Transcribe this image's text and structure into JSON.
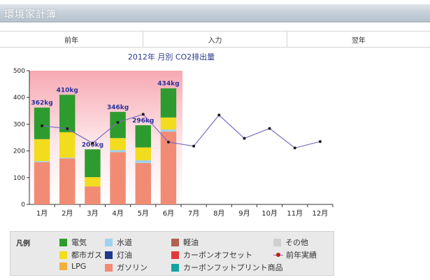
{
  "window": {
    "title": "環境家計簿"
  },
  "nav": {
    "prev": "前年",
    "input": "入力",
    "next": "翌年"
  },
  "colors": {
    "electricity": "#2e9b2e",
    "city_gas": "#f2dc1e",
    "lpg": "#f0b040",
    "water": "#9fd2f0",
    "kerosene": "#1f3a8c",
    "gasoline": "#f28b73",
    "light_oil": "#b06050",
    "carbon_offset": "#e03a3a",
    "carbon_footprint": "#13a3a3",
    "other": "#cfcfcf",
    "prev_year_line": "#7b6bc2",
    "prev_year_marker": "#1a1a1a"
  },
  "chart_data": {
    "type": "bar",
    "title": "2012年 月別 CO2排出量",
    "categories": [
      "1月",
      "2月",
      "3月",
      "4月",
      "5月",
      "6月",
      "7月",
      "8月",
      "9月",
      "10月",
      "11月",
      "12月"
    ],
    "ylim": [
      0,
      500
    ],
    "yticks": [
      0,
      100,
      200,
      300,
      400,
      500
    ],
    "stacked": true,
    "series": [
      {
        "name": "ガソリン",
        "color_key": "gasoline",
        "values": [
          158,
          172,
          67,
          195,
          155,
          272,
          null,
          null,
          null,
          null,
          null,
          null
        ]
      },
      {
        "name": "水道",
        "color_key": "water",
        "values": [
          4,
          3,
          0,
          8,
          10,
          8,
          null,
          null,
          null,
          null,
          null,
          null
        ]
      },
      {
        "name": "都市ガス",
        "color_key": "city_gas",
        "values": [
          82,
          95,
          35,
          45,
          48,
          45,
          null,
          null,
          null,
          null,
          null,
          null
        ]
      },
      {
        "name": "電気",
        "color_key": "electricity",
        "values": [
          118,
          140,
          104,
          98,
          83,
          109,
          null,
          null,
          null,
          null,
          null,
          null
        ]
      }
    ],
    "totals_labels": [
      "362kg",
      "410kg",
      "206kg",
      "346kg",
      "296kg",
      "434kg",
      "",
      "",
      "",
      "",
      "",
      ""
    ],
    "prev_year": {
      "name": "前年実績",
      "values": [
        294,
        283,
        229,
        307,
        337,
        233,
        218,
        334,
        247,
        284,
        211,
        235
      ]
    },
    "legend": {
      "title": "凡例",
      "items": [
        {
          "label": "電気",
          "color_key": "electricity"
        },
        {
          "label": "水道",
          "color_key": "water"
        },
        {
          "label": "軽油",
          "color_key": "light_oil"
        },
        {
          "label": "その他",
          "color_key": "other"
        },
        {
          "label": "都市ガス",
          "color_key": "city_gas"
        },
        {
          "label": "灯油",
          "color_key": "kerosene"
        },
        {
          "label": "カーボンオフセット",
          "color_key": "carbon_offset"
        },
        {
          "label": "前年実績",
          "color_key": "prev_year_marker",
          "line": true
        },
        {
          "label": "LPG",
          "color_key": "lpg"
        },
        {
          "label": "ガソリン",
          "color_key": "gasoline"
        },
        {
          "label": "カーボンフットプリント商品",
          "color_key": "carbon_footprint"
        }
      ]
    }
  }
}
